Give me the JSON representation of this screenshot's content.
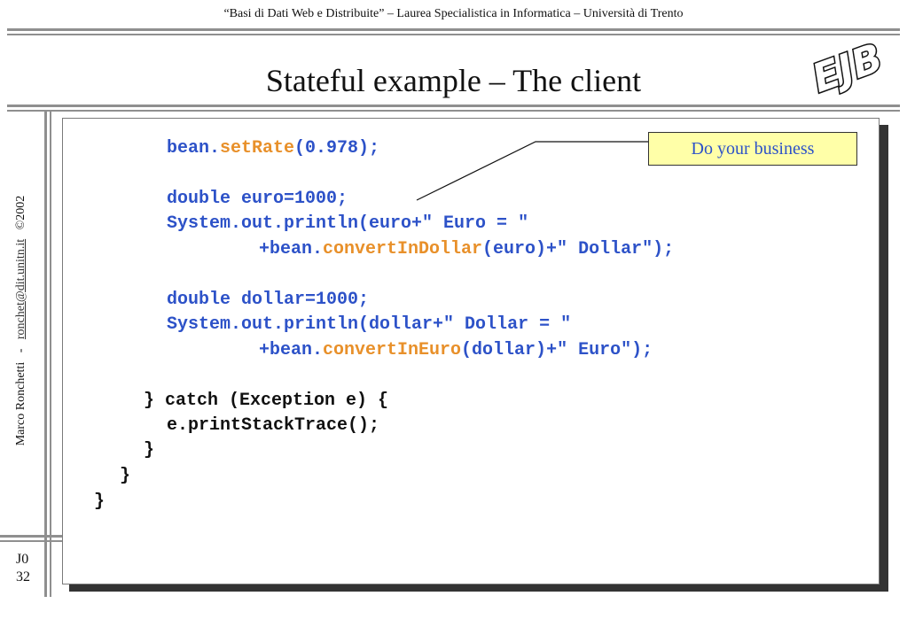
{
  "header": {
    "course": "“Basi di Dati Web e Distribuite” – Laurea Specialistica in Informatica – Università di Trento"
  },
  "slide": {
    "title": "Stateful example – The client",
    "logo_text": "EJB"
  },
  "sidebar": {
    "author": "Marco Ronchetti",
    "separator": "-",
    "email": "ronchet@dit.unitn.it",
    "copyright": "©2002",
    "section": "J0",
    "page": "32"
  },
  "callout": {
    "text": "Do your business"
  },
  "code": {
    "l1a": "bean.",
    "l1b": "setRate",
    "l1c": "(0.978);",
    "l2": "double euro=1000;",
    "l3": "System.out.println(euro+\" Euro = \"",
    "l4a": "+bean.",
    "l4b": "convertInDollar",
    "l4c": "(euro)+\" Dollar\");",
    "l5": "double dollar=1000;",
    "l6": "System.out.println(dollar+\" Dollar = \"",
    "l7a": "+bean.",
    "l7b": "convertInEuro",
    "l7c": "(dollar)+\" Euro\");",
    "l8": "} catch (Exception e) {",
    "l9": "e.printStackTrace();",
    "l10": "}",
    "l11": "}",
    "l12": "}"
  },
  "colors": {
    "code_blue": "#2d52c8",
    "code_orange": "#e8902a",
    "callout_bg": "#ffffa8"
  }
}
